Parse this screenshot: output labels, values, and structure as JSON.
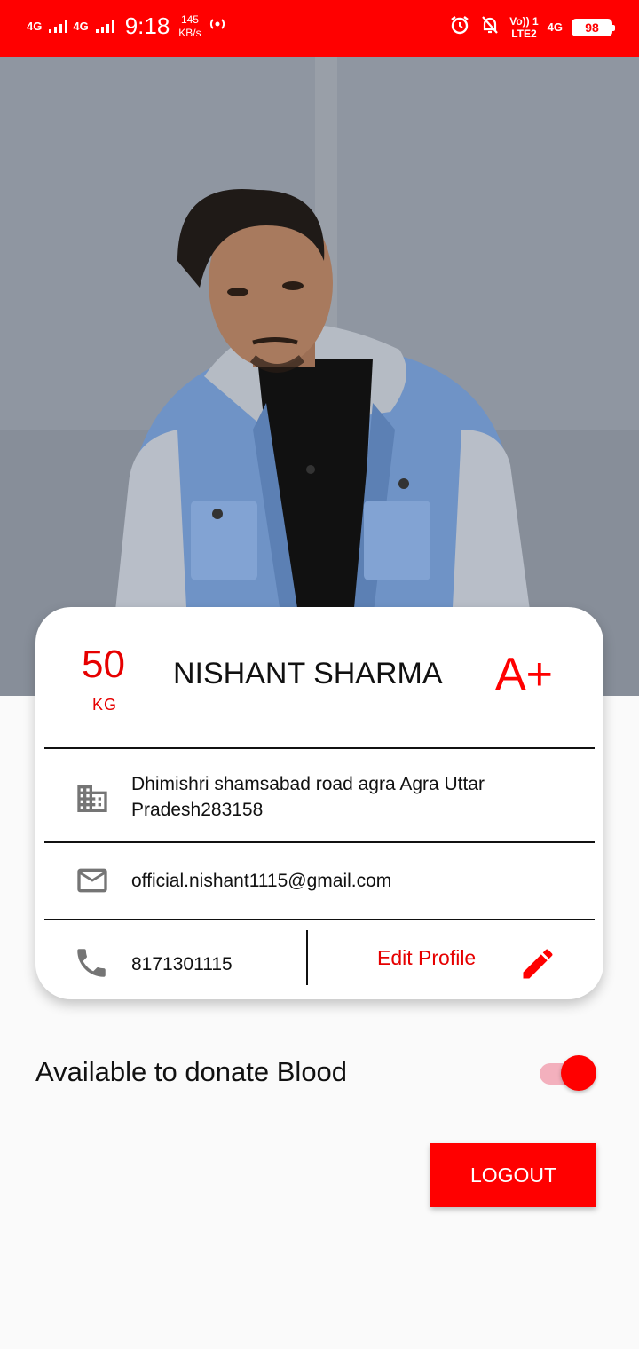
{
  "status_bar": {
    "network1": "4G",
    "network2": "4G",
    "time": "9:18",
    "speed_value": "145",
    "speed_unit": "KB/s",
    "volte": "Vo)) 1",
    "lte": "LTE2",
    "net_right": "4G",
    "battery": "98",
    "icons": [
      "signal-icon",
      "signal-icon",
      "hotspot-icon",
      "alarm-icon",
      "notifications-off-icon",
      "battery-icon"
    ]
  },
  "profile": {
    "photo": "profile-photo",
    "weight": "50",
    "weight_unit": "KG",
    "name": "NISHANT SHARMA",
    "blood_group": "A+",
    "address": "Dhimishri shamsabad road agra Agra Uttar Pradesh283158",
    "email": "official.nishant1115@gmail.com",
    "phone": "8171301115",
    "edit_label": "Edit Profile",
    "icons": {
      "address": "building-icon",
      "email": "mail-icon",
      "phone": "phone-icon",
      "edit": "pencil-icon"
    }
  },
  "availability": {
    "label": "Available to donate Blood",
    "enabled": true
  },
  "actions": {
    "logout_label": "LOGOUT"
  },
  "colors": {
    "accent": "#ff0000",
    "text": "#111111",
    "background": "#fafafa",
    "toggle_track": "#f3b0bd",
    "icon_gray": "#757575"
  }
}
